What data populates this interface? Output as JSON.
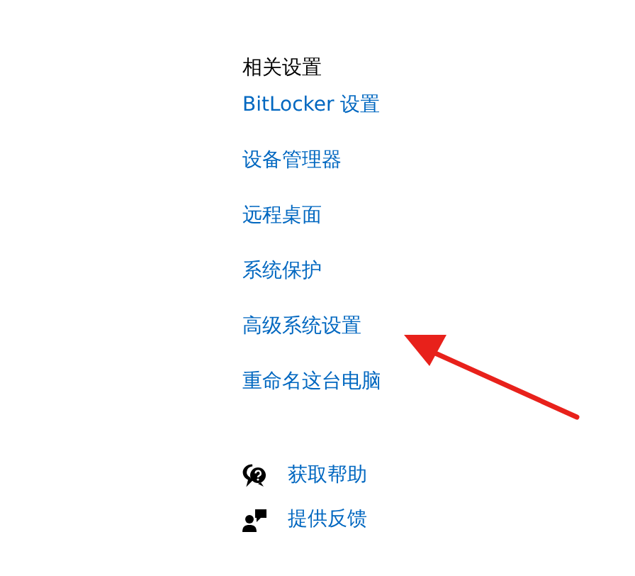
{
  "related_settings": {
    "heading": "相关设置",
    "links": [
      {
        "label": "BitLocker 设置"
      },
      {
        "label": "设备管理器"
      },
      {
        "label": "远程桌面"
      },
      {
        "label": "系统保护"
      },
      {
        "label": "高级系统设置"
      },
      {
        "label": "重命名这台电脑"
      }
    ]
  },
  "support_links": [
    {
      "kind": "help",
      "label": "获取帮助"
    },
    {
      "kind": "feedback",
      "label": "提供反馈"
    }
  ]
}
